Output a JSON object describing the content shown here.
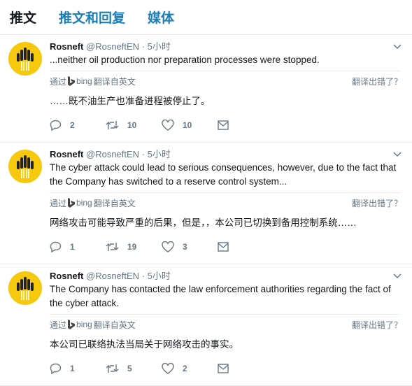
{
  "tabs": [
    {
      "label": "推文",
      "active": true
    },
    {
      "label": "推文和回复",
      "active": false
    },
    {
      "label": "媒体",
      "active": false
    }
  ],
  "colors": {
    "accent": "#1b7eb5",
    "avatar": "#f6c90e",
    "muted": "#657786"
  },
  "tweets": [
    {
      "name": "Rosneft",
      "handle": "@RosneftEN",
      "time": "· 5小时",
      "text": "...neither oil production nor preparation processes were stopped.",
      "via": "通过",
      "bing": "bing",
      "translated_from": "翻译自英文",
      "wrong": "翻译出错了？",
      "translation": "……既不油生产也准备进程被停止了。",
      "replies": "2",
      "retweets": "10",
      "likes": "10"
    },
    {
      "name": "Rosneft",
      "handle": "@RosneftEN",
      "time": "· 5小时",
      "text": "The cyber attack could lead to serious consequences, however, due to the fact that the Company has switched to a reserve control system...",
      "via": "通过",
      "bing": "bing",
      "translated_from": "翻译自英文",
      "wrong": "翻译出错了？",
      "translation": "网络攻击可能导致严重的后果，但是，，本公司已切换到备用控制系统……",
      "replies": "1",
      "retweets": "19",
      "likes": "3"
    },
    {
      "name": "Rosneft",
      "handle": "@RosneftEN",
      "time": "· 5小时",
      "text": "The Company has contacted the law enforcement authorities regarding the fact of the cyber attack.",
      "via": "通过",
      "bing": "bing",
      "translated_from": "翻译自英文",
      "wrong": "翻译出错了？",
      "translation": "本公司已联络执法当局关于网络攻击的事实。",
      "replies": "1",
      "retweets": "5",
      "likes": "2"
    }
  ]
}
